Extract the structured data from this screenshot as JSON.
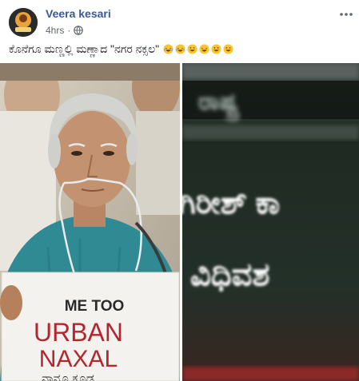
{
  "post": {
    "author": "Veera kesari",
    "time": "4hrs",
    "caption": "ಕೊನೆಗೂ ಮಣ್ಣಲ್ಲಿ ಮಣ್ಣಾದ \"ನಗರ ನಕ್ಸಲ\"",
    "emojis": [
      "laughing-tears",
      "laughing-tears",
      "grinning",
      "laughing-tears",
      "grinning",
      "grinning"
    ]
  },
  "photo_left": {
    "sign_line1": "ME TOO",
    "sign_line2": "URBAN",
    "sign_line3": "NAXAL",
    "sign_line4": "ನಾನೂ ಕೂಡ"
  },
  "photo_right": {
    "top_text": "ರಾಷ್ಟ್ರ",
    "line1": "ಗಿರೀಶ್ ಕಾ",
    "line2": "ವಿಧಿವಶ"
  },
  "colors": {
    "author_link": "#385898",
    "meta_gray": "#616770",
    "urban_red": "#b3262e",
    "screen_bg": "#1f2a22"
  }
}
